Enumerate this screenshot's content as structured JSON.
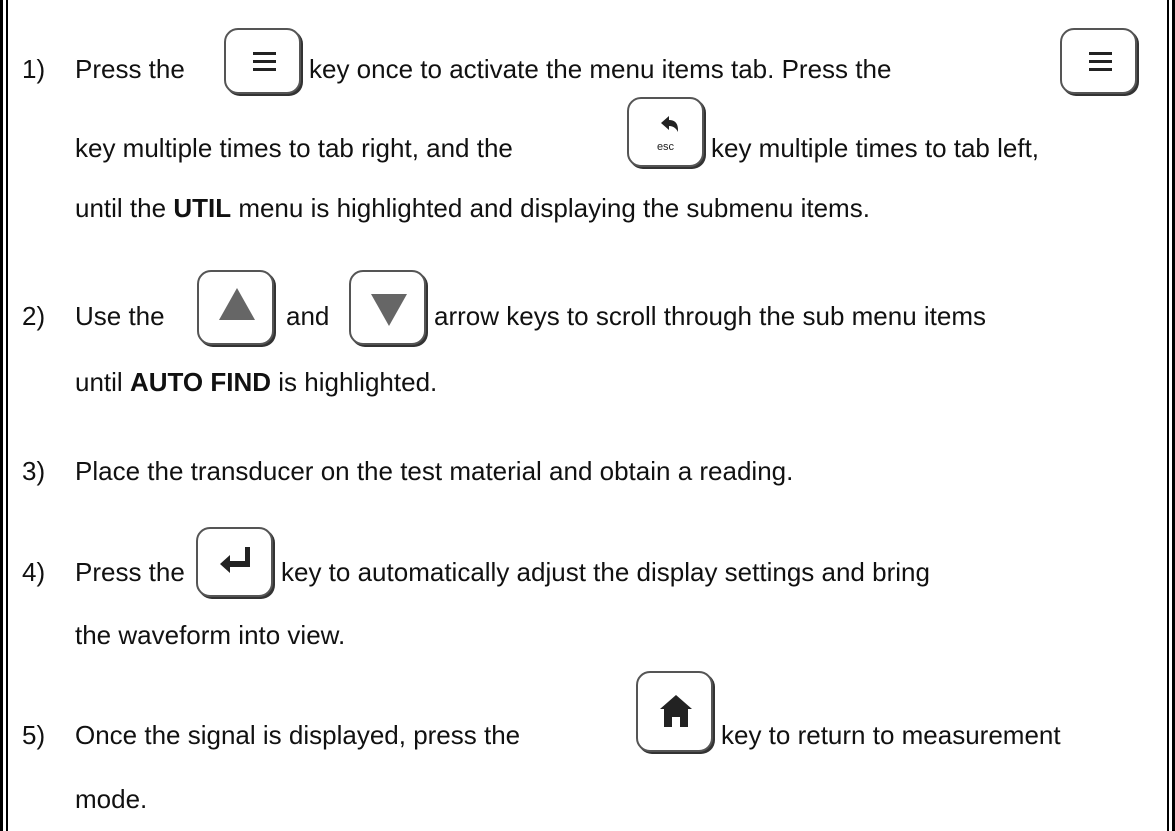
{
  "steps": [
    {
      "number": "1)",
      "line1": {
        "a": "Press the",
        "b": "key once to activate the menu items tab.  Press the"
      },
      "line2": {
        "a": "key multiple times to tab right, and the",
        "b": "key multiple times to tab left,"
      },
      "line3": {
        "a": "until the",
        "bold": "UTIL",
        "b": "menu is highlighted and displaying the submenu items."
      }
    },
    {
      "number": "2)",
      "line1": {
        "a": "Use the",
        "b": "and",
        "c": "arrow keys to scroll through the sub menu items"
      },
      "line2": {
        "a": "until",
        "bold": "AUTO FIND",
        "b": "is highlighted."
      }
    },
    {
      "number": "3)",
      "line1": {
        "a": "Place the transducer on the test material and obtain a reading."
      }
    },
    {
      "number": "4)",
      "line1": {
        "a": "Press the",
        "b": "key to automatically adjust the display settings and bring"
      },
      "line2": {
        "a": "the waveform into view."
      }
    },
    {
      "number": "5)",
      "line1": {
        "a": "Once the signal is displayed, press the",
        "b": "key to return to measurement"
      },
      "line2": {
        "a": "mode."
      }
    }
  ],
  "keys": {
    "menu": "menu-icon",
    "esc": "back-arrow-icon",
    "esc_label": "esc",
    "up": "up-triangle-icon",
    "down": "down-triangle-icon",
    "enter": "enter-arrow-icon",
    "home": "home-icon"
  }
}
